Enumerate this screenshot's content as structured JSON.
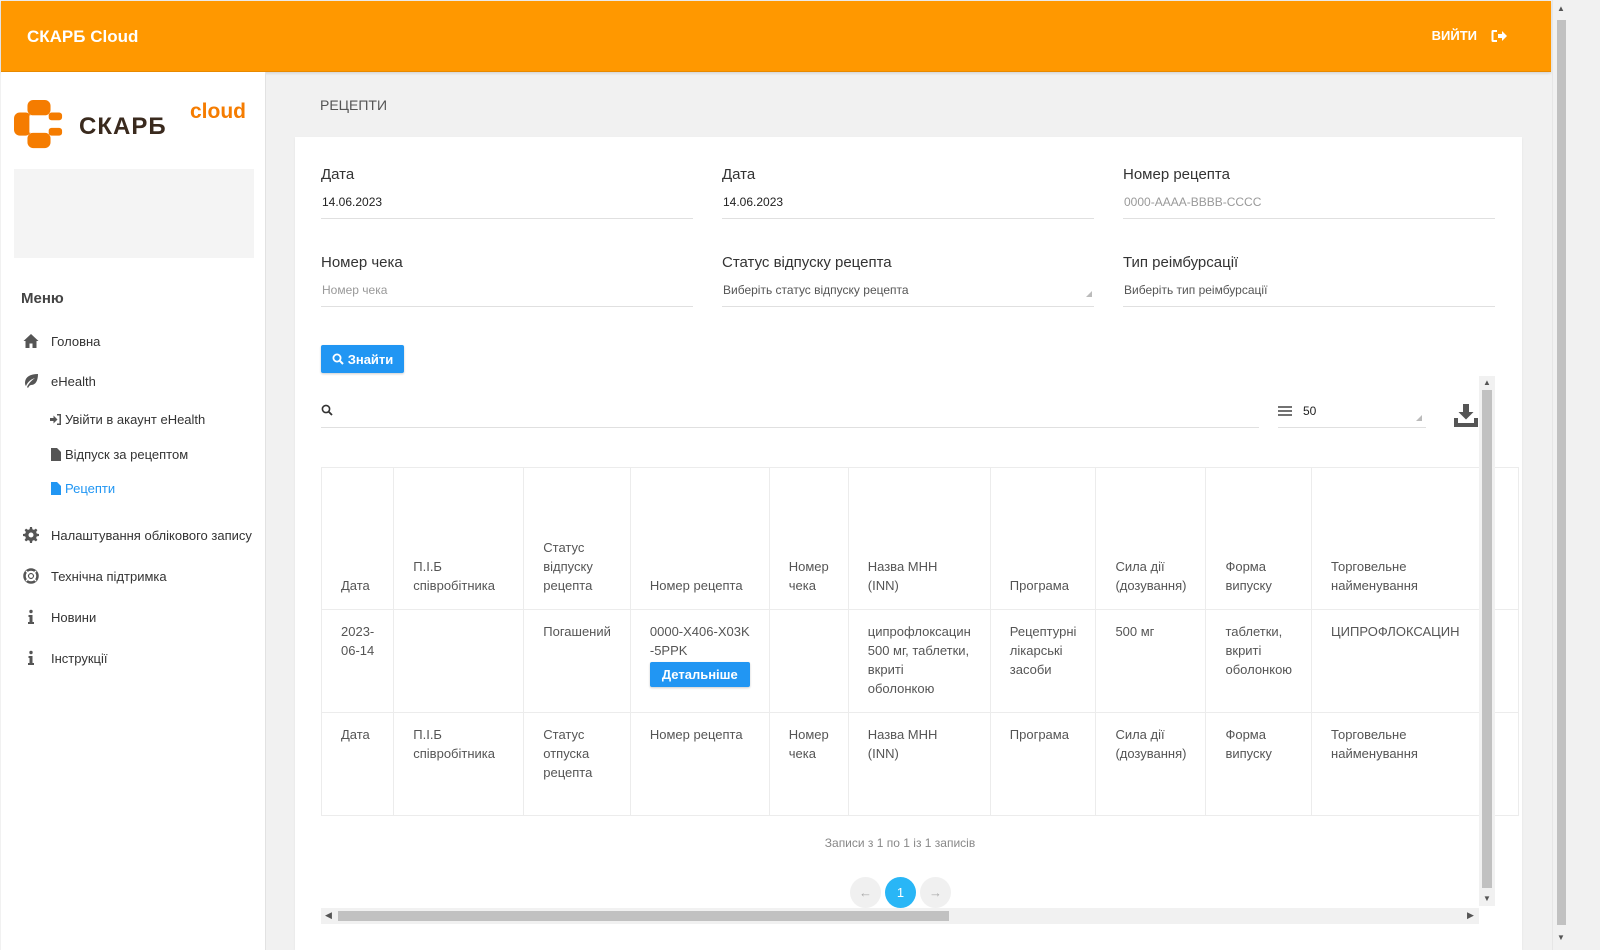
{
  "topbar": {
    "brand": "СКАРБ Cloud",
    "logout_label": "ВИЙТИ",
    "logout_icon": "sign-out-icon",
    "bg_color": "#ff9800"
  },
  "logo": {
    "word": "СКАРБ",
    "cloud": "cloud"
  },
  "sidebar": {
    "menu_title": "Меню",
    "items": [
      {
        "label": "Головна",
        "icon": "home-icon"
      },
      {
        "label": "eHealth",
        "icon": "leaf-icon"
      },
      {
        "label": "Налаштування облікового запису",
        "icon": "gear-icon"
      },
      {
        "label": "Технічна підтримка",
        "icon": "lifebuoy-icon"
      },
      {
        "label": "Новини",
        "icon": "info-icon"
      },
      {
        "label": "Інструкції",
        "icon": "info-icon"
      }
    ],
    "sub_items": [
      {
        "label": "Увійти в акаунт eHealth",
        "icon": "sign-in-icon"
      },
      {
        "label": "Відпуск за рецептом",
        "icon": "file-icon"
      },
      {
        "label": "Рецепти",
        "icon": "file-icon",
        "active": true
      }
    ],
    "active_color": "#2196f3"
  },
  "page": {
    "title": "РЕЦЕПТИ"
  },
  "filters": {
    "date_from": {
      "label": "Дата",
      "value": "14.06.2023"
    },
    "date_to": {
      "label": "Дата",
      "value": "14.06.2023"
    },
    "recipe_number": {
      "label": "Номер рецепта",
      "placeholder": "0000-AAAA-BBBB-CCCC"
    },
    "check_number": {
      "label": "Номер чека",
      "placeholder": "Номер чека"
    },
    "status": {
      "label": "Статус відпуску рецепта",
      "selected": "Виберіть статус відпуску рецепта"
    },
    "reimbursement": {
      "label": "Тип реімбурсації",
      "selected": "Виберіть тип реімбурсації"
    },
    "find_label": "Знайти"
  },
  "table_controls": {
    "page_length": "50",
    "download_icon": "download-icon"
  },
  "table": {
    "headers": [
      "Дата",
      "П.І.Б співробітника",
      "Статус відпуску рецепта",
      "Номер рецепта",
      "Номер чека",
      "Назва МНН (INN)",
      "Програма",
      "Сила дії (дозування)",
      "Форма випуску",
      "Торговельне найменування"
    ],
    "row": {
      "date": "2023-06-14",
      "employee": "",
      "status": "Погашений",
      "recipe_number": "0000-X406-X03K-5PPK",
      "detail_label": "Детальніше",
      "check_number": "",
      "inn": "ципрофлоксацин 500 мг, таблетки, вкриті оболонкою",
      "program": "Рецептурні лікарські засоби",
      "dosage": "500 мг",
      "form": "таблетки, вкриті оболонкою",
      "trade_name": "ЦИПРОФЛОКСАЦИН"
    },
    "footer": [
      "Дата",
      "П.І.Б співробітника",
      "Статус отпуска рецепта",
      "Номер рецепта",
      "Номер чека",
      "Назва МНН (INN)",
      "Програма",
      "Сила дії (дозування)",
      "Форма випуску",
      "Торговельне найменування"
    ]
  },
  "info": "Записи з 1 по 1 із 1 записів",
  "pager": {
    "prev": "←",
    "current": "1",
    "next": "→"
  }
}
